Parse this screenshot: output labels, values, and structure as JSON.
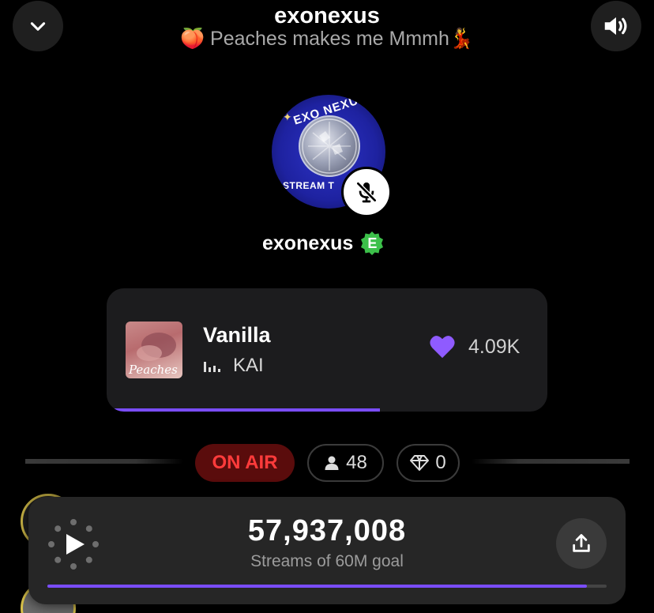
{
  "header": {
    "room_name": "exonexus",
    "room_topic": "🍑 Peaches makes me Mmmh💃",
    "collapse_icon": "chevron-down-icon",
    "sound_icon": "speaker-icon"
  },
  "host": {
    "avatar_top_text": "EXO NEXUS",
    "avatar_bottom_text": "STREAM T",
    "name": "exonexus",
    "badge_letter": "E",
    "muted": true
  },
  "now_playing": {
    "cover_text": "Peaches",
    "title": "Vanilla",
    "artist": "KAI",
    "likes": "4.09K",
    "progress_fraction": 0.62
  },
  "status": {
    "on_air_label": "ON AIR",
    "listeners": "48",
    "gems": "0"
  },
  "stream_goal": {
    "count": "57,937,008",
    "label": "Streams of 60M goal",
    "progress_fraction": 0.965
  },
  "colors": {
    "accent": "#7a4dff",
    "on_air_text": "#ff3b3b",
    "on_air_bg": "#5a0c0c",
    "verified": "#3cc04a"
  }
}
